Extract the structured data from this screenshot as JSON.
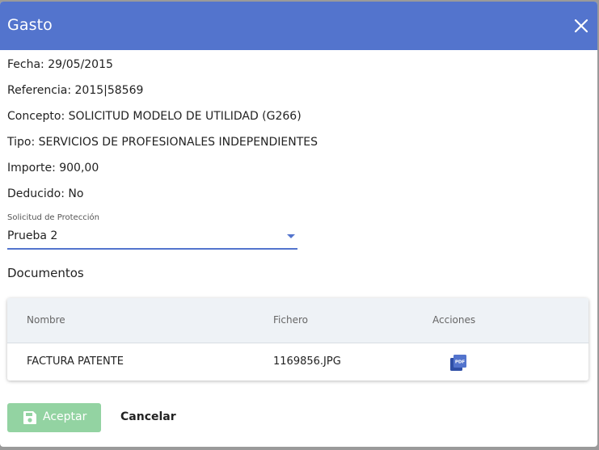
{
  "dialog": {
    "title": "Gasto",
    "close_icon": "close-icon"
  },
  "details": {
    "fecha": "Fecha: 29/05/2015",
    "referencia": "Referencia: 2015|58569",
    "concepto": "Concepto: SOLICITUD MODELO DE UTILIDAD (G266)",
    "tipo": "Tipo: SERVICIOS DE PROFESIONALES INDEPENDIENTES",
    "importe": "Importe: 900,00",
    "deducido": "Deducido: No"
  },
  "solicitud": {
    "label": "Solicitud de Protección",
    "value": "Prueba 2"
  },
  "documentos": {
    "title": "Documentos",
    "columns": [
      "Nombre",
      "Fichero",
      "Acciones"
    ],
    "rows": [
      {
        "nombre": "FACTURA PATENTE",
        "fichero": "1169856.JPG",
        "action_icon": "pdf-icon"
      }
    ]
  },
  "actions": {
    "accept_label": "Aceptar",
    "accept_icon": "save-icon",
    "cancel_label": "Cancelar"
  },
  "colors": {
    "header": "#5374cd",
    "accept_button": "#93d3a2",
    "table_header": "#eef2f6"
  }
}
